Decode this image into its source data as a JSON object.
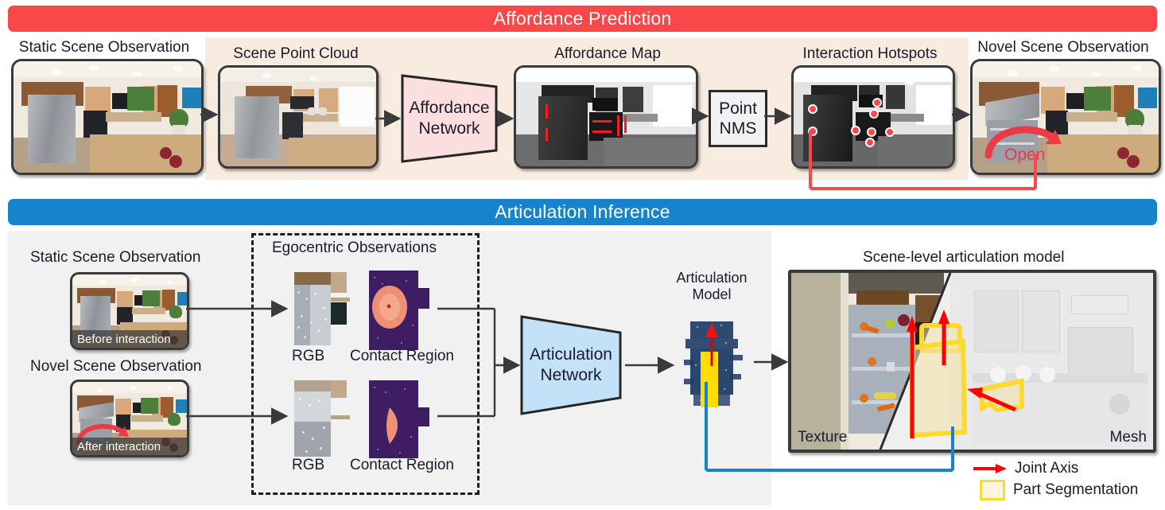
{
  "figure": {
    "sections": [
      {
        "id": "affordance",
        "title": "Affordance Prediction",
        "color": "#f9474a"
      },
      {
        "id": "articulation",
        "title": "Articulation Inference",
        "color": "#1783cb"
      }
    ]
  },
  "affordance": {
    "title": "Affordance Prediction",
    "stages": [
      {
        "key": "static_scene",
        "label": "Static Scene Observation"
      },
      {
        "key": "point_cloud",
        "label": "Scene Point Cloud"
      },
      {
        "key": "affordance_net",
        "label": "Affordance\nNetwork",
        "line1": "Affordance",
        "line2": "Network",
        "fill": "#fbdede"
      },
      {
        "key": "affordance_map",
        "label": "Affordance Map"
      },
      {
        "key": "point_nms",
        "label": "Point\nNMS",
        "line1": "Point",
        "line2": "NMS",
        "fill": "#f2f2f2"
      },
      {
        "key": "hotspots",
        "label": "Interaction Hotspots"
      },
      {
        "key": "novel_scene",
        "label": "Novel Scene Observation"
      }
    ],
    "open_annotation": "Open",
    "panel_bg": "#f7ecdf",
    "hotspot_color": "#f9474a",
    "hotspot_count": 7
  },
  "articulation": {
    "title": "Articulation Inference",
    "panel_bg": "#f1f1f1",
    "inputs": [
      {
        "caption": "Static Scene Observation",
        "badge": "Before interaction"
      },
      {
        "caption": "Novel Scene Observation",
        "badge": "After interaction"
      }
    ],
    "egocentric": {
      "title": "Egocentric Observations",
      "rows": [
        {
          "rgb_label": "RGB",
          "contact_label": "Contact Region"
        },
        {
          "rgb_label": "RGB",
          "contact_label": "Contact Region"
        }
      ]
    },
    "network": {
      "line1": "Articulation",
      "line2": "Network",
      "fill": "#c4e2f7"
    },
    "model": {
      "line1": "Articulation",
      "line2": "Model"
    },
    "output": {
      "title": "Scene-level articulation model",
      "left_label": "Texture",
      "right_label": "Mesh"
    },
    "legend": [
      {
        "type": "arrow",
        "label": "Joint Axis",
        "color": "#ff0000"
      },
      {
        "type": "swatch",
        "label": "Part Segmentation",
        "color": "#ffd92e"
      }
    ],
    "flow_color": "#1783cb"
  }
}
